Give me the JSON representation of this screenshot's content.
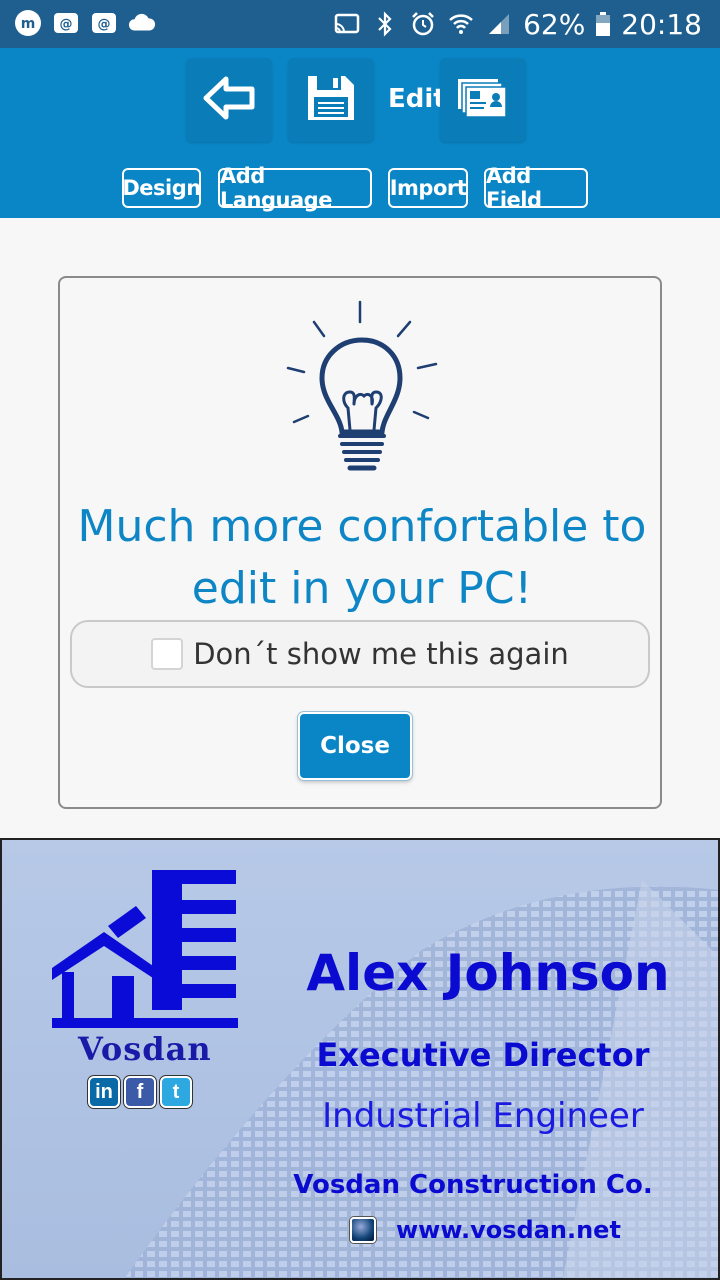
{
  "status_bar": {
    "battery": "62%",
    "time": "20:18",
    "left_icons": [
      "messenger-icon",
      "email-icon",
      "email-icon",
      "cloud-icon"
    ],
    "right_icons": [
      "cast-icon",
      "bluetooth-icon",
      "alarm-icon",
      "wifi-icon",
      "signal-icon",
      "battery-icon"
    ]
  },
  "toolbar": {
    "back_icon": "back-arrow-icon",
    "save_icon": "floppy-disk-icon",
    "edit_label": "Edit",
    "card_icon": "business-card-icon",
    "tabs": [
      "Design",
      "Add Language",
      "Import",
      "Add Field"
    ]
  },
  "dialog": {
    "icon": "lightbulb-icon",
    "message_line1": "Much more confortable to",
    "message_line2": "edit in your PC!",
    "dont_show_label": "Don´t show me this again",
    "dont_show_checked": false,
    "close_label": "Close"
  },
  "card": {
    "logo_text": "Vosdan",
    "social_icons": [
      "linkedin-icon",
      "facebook-icon",
      "twitter-icon"
    ],
    "name": "Alex Johnson",
    "title": "Executive Director",
    "role": "Industrial Engineer",
    "company": "Vosdan Construction Co.",
    "website": "www.vosdan.net"
  },
  "colors": {
    "status_bar": "#1f5f8f",
    "toolbar": "#0a86c6",
    "accent_text": "#0e86c6",
    "card_text": "#0a0ad0"
  }
}
